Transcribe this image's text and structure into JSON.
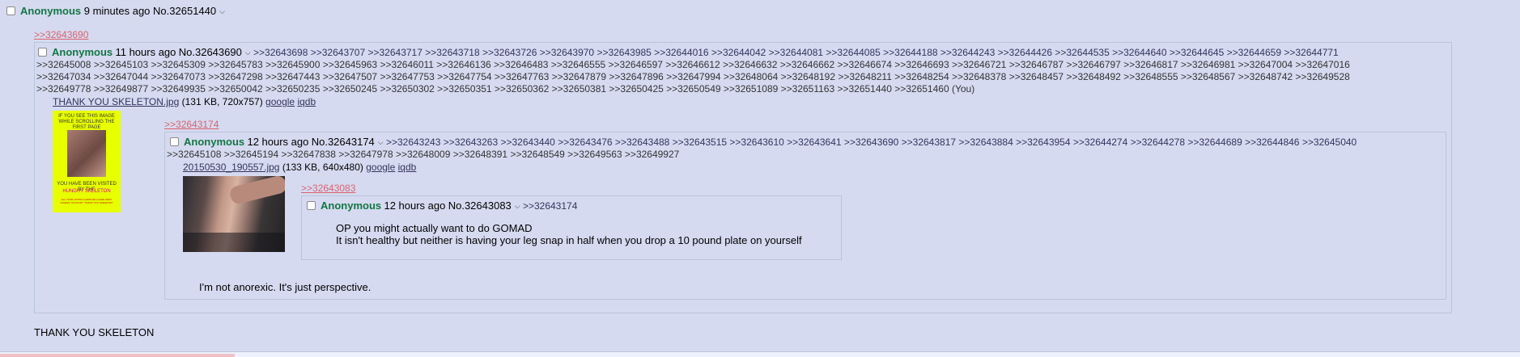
{
  "post_root": {
    "name": "Anonymous",
    "time": "9 minutes ago",
    "number": "No.32651440",
    "quote": ">>32643690",
    "message": "THANK YOU SKELETON"
  },
  "post_mid": {
    "name": "Anonymous",
    "time": "11 hours ago",
    "number": "No.32643690",
    "backlinks_line1": ">>32643698 >>32643707 >>32643717 >>32643718 >>32643726 >>32643970 >>32643985 >>32644016 >>32644042 >>32644081 >>32644085 >>32644188 >>32644243 >>32644426 >>32644535 >>32644640 >>32644645 >>32644659 >>32644771",
    "backlinks_line2": ">>32645008 >>32645103 >>32645309 >>32645783 >>32645900 >>32645963 >>32646011 >>32646136 >>32646483 >>32646555 >>32646597 >>32646612 >>32646632 >>32646662 >>32646674 >>32646693 >>32646721 >>32646787 >>32646797 >>32646817 >>32646981 >>32647004 >>32647016",
    "backlinks_line3": ">>32647034 >>32647044 >>32647073 >>32647298 >>32647443 >>32647507 >>32647753 >>32647754 >>32647763 >>32647879 >>32647896 >>32647994 >>32648064 >>32648192 >>32648211 >>32648254 >>32648378 >>32648457 >>32648492 >>32648555 >>32648567 >>32648742 >>32649528",
    "backlinks_line4": ">>32649778 >>32649877 >>32649935 >>32650042 >>32650235 >>32650245 >>32650302 >>32650351 >>32650362 >>32650381 >>32650425 >>32650549 >>32651089 >>32651163 >>32651440 >>32651460 (You)",
    "file_name": "THANK YOU SKELETON.jpg",
    "file_info": "(131 KB, 720x757)",
    "google": "google",
    "iqdb": "iqdb",
    "quote": ">>32643174",
    "thumb_text_top": "IF YOU SEE THIS IMAGE WHILE SCROLLING THE FIRST PAGE",
    "thumb_text_mid": "YOU HAVE BEEN VISITED BY THE",
    "thumb_text_hungry": "HUNGRY SKELETON",
    "thumb_text_small": "ALL YOUR LIFTING GAINS WILL FADE AWAY UNLESS YOU POST \"THANK YOU SKELETON\""
  },
  "post_inner": {
    "name": "Anonymous",
    "time": "12 hours ago",
    "number": "No.32643174",
    "backlinks_line1": ">>32643243 >>32643263 >>32643440 >>32643476 >>32643488 >>32643515 >>32643610 >>32643641 >>32643690 >>32643817 >>32643884 >>32643954 >>32644274 >>32644278 >>32644689 >>32644846 >>32645040",
    "backlinks_line2": ">>32645108 >>32645194 >>32647838 >>32647978 >>32648009 >>32648391 >>32648549 >>32649563 >>32649927",
    "file_name": "20150530_190557.jpg",
    "file_info": "(133 KB, 640x480)",
    "google": "google",
    "iqdb": "iqdb",
    "quote": ">>32643083",
    "message": "I'm not anorexic. It's just perspective."
  },
  "post_deep": {
    "name": "Anonymous",
    "time": "12 hours ago",
    "number": "No.32643083",
    "backlink": ">>32643174",
    "message_line1": "OP you might actually want to do GOMAD",
    "message_line2": "It isn't healthy but neither is having your leg snap in half when you drop a 10 pound plate on yourself"
  }
}
